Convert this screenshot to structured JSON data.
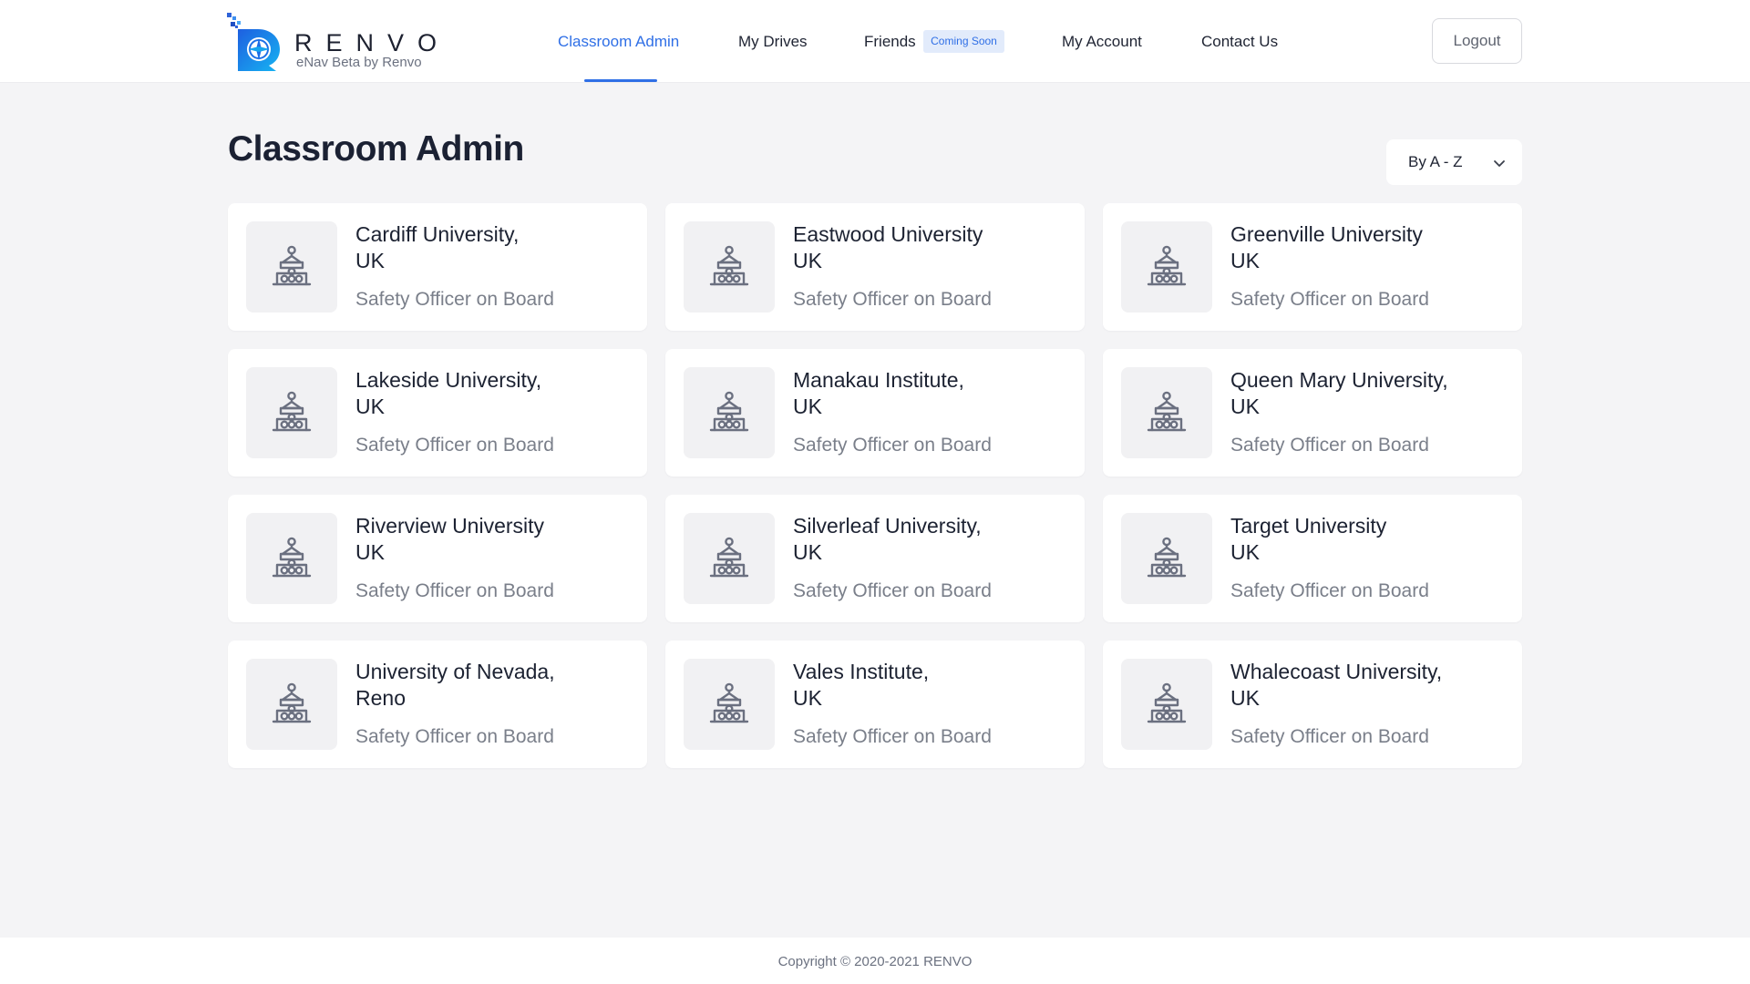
{
  "brand": {
    "name": "RENVO",
    "subtitle": "eNav Beta by Renvo",
    "accent_color": "#2f6fe6"
  },
  "nav": {
    "items": [
      {
        "label": "Classroom Admin",
        "active": true
      },
      {
        "label": "My Drives",
        "active": false
      },
      {
        "label": "Friends",
        "active": false,
        "badge": "Coming Soon"
      },
      {
        "label": "My Account",
        "active": false
      },
      {
        "label": "Contact Us",
        "active": false
      }
    ],
    "logout_label": "Logout"
  },
  "page": {
    "title": "Classroom Admin",
    "sort": {
      "selected": "By A - Z"
    }
  },
  "cards": [
    {
      "line1": "Cardiff University,",
      "line2": "UK",
      "subtitle": "Safety Officer on Board",
      "icon": "building-icon"
    },
    {
      "line1": "Eastwood University",
      "line2": "UK",
      "subtitle": "Safety Officer on Board",
      "icon": "building-icon"
    },
    {
      "line1": "Greenville University",
      "line2": "UK",
      "subtitle": "Safety Officer on Board",
      "icon": "building-icon"
    },
    {
      "line1": "Lakeside University,",
      "line2": "UK",
      "subtitle": "Safety Officer on Board",
      "icon": "building-icon"
    },
    {
      "line1": "Manakau Institute,",
      "line2": "UK",
      "subtitle": "Safety Officer on Board",
      "icon": "building-icon"
    },
    {
      "line1": "Queen Mary University,",
      "line2": "UK",
      "subtitle": "Safety Officer on Board",
      "icon": "building-icon"
    },
    {
      "line1": "Riverview University",
      "line2": "UK",
      "subtitle": "Safety Officer on Board",
      "icon": "building-icon"
    },
    {
      "line1": "Silverleaf University,",
      "line2": "UK",
      "subtitle": "Safety Officer on Board",
      "icon": "building-icon"
    },
    {
      "line1": "Target University",
      "line2": "UK",
      "subtitle": "Safety Officer on Board",
      "icon": "building-icon"
    },
    {
      "line1": "University of Nevada,",
      "line2": "Reno",
      "subtitle": "Safety Officer on Board",
      "icon": "building-icon"
    },
    {
      "line1": "Vales Institute,",
      "line2": "UK",
      "subtitle": "Safety Officer on Board",
      "icon": "building-icon"
    },
    {
      "line1": "Whalecoast University,",
      "line2": "UK",
      "subtitle": "Safety Officer on Board",
      "icon": "building-icon"
    }
  ],
  "footer": {
    "copyright": "Copyright © 2020-2021 RENVO"
  }
}
